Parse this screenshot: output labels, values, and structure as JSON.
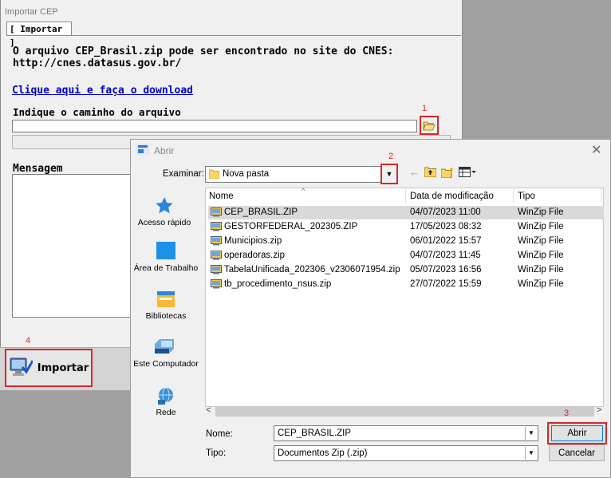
{
  "main_window": {
    "title": "Importar CEP",
    "tab": "[ Importar ]",
    "info_line1": "O arquivo CEP_Brasil.zip pode ser encontrado no site do CNES:",
    "info_line2": "http://cnes.datasus.gov.br/",
    "download_link": "Clique aqui e faça o download",
    "path_label": "Indique o caminho do arquivo",
    "path_value": "",
    "message_label": "Mensagem",
    "import_button": "Importar"
  },
  "annotations": {
    "step1": "1",
    "step2": "2",
    "step3": "3",
    "step4": "4"
  },
  "dialog": {
    "title": "Abrir",
    "look_in_label": "Examinar:",
    "look_in_value": "Nova pasta",
    "places": [
      {
        "label": "Acesso rápido",
        "icon": "star-icon"
      },
      {
        "label": "Área de Trabalho",
        "icon": "desktop-icon"
      },
      {
        "label": "Bibliotecas",
        "icon": "library-icon"
      },
      {
        "label": "Este Computador",
        "icon": "computer-icon"
      },
      {
        "label": "Rede",
        "icon": "network-icon"
      }
    ],
    "columns": {
      "name": "Nome",
      "modified": "Data de modificação",
      "type": "Tipo"
    },
    "files": [
      {
        "name": "CEP_BRASIL.ZIP",
        "modified": "04/07/2023 11:00",
        "type": "WinZip File"
      },
      {
        "name": "GESTORFEDERAL_202305.ZIP",
        "modified": "17/05/2023 08:32",
        "type": "WinZip File"
      },
      {
        "name": "Municipios.zip",
        "modified": "06/01/2022 15:57",
        "type": "WinZip File"
      },
      {
        "name": "operadoras.zip",
        "modified": "04/07/2023 11:45",
        "type": "WinZip File"
      },
      {
        "name": "TabelaUnificada_202306_v2306071954.zip",
        "modified": "05/07/2023 16:56",
        "type": "WinZip File"
      },
      {
        "name": "tb_procedimento_nsus.zip",
        "modified": "27/07/2022 15:59",
        "type": "WinZip File"
      }
    ],
    "selected_file": "CEP_BRASIL.ZIP",
    "name_label": "Nome:",
    "name_value": "CEP_BRASIL.ZIP",
    "type_label": "Tipo:",
    "type_value": "Documentos Zip (.zip)",
    "open_button": "Abrir",
    "cancel_button": "Cancelar"
  },
  "colors": {
    "highlight": "#d9262a",
    "link": "#0000cc",
    "selection": "#d9d9d9"
  }
}
